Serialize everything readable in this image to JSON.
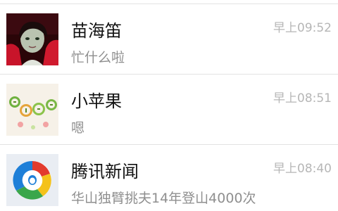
{
  "conversations": [
    {
      "name": "苗海笛",
      "time": "早上09:52",
      "preview": "忙什么啦",
      "avatar_icon": "person-photo-avatar"
    },
    {
      "name": "小苹果",
      "time": "早上08:51",
      "preview": "嗯",
      "avatar_icon": "xiao-pingguo-logo-avatar"
    },
    {
      "name": "腾讯新闻",
      "time": "早上08:40",
      "preview": "华山独臂挑夫14年登山4000次",
      "avatar_icon": "tencent-news-logo-avatar"
    }
  ],
  "colors": {
    "name_text": "#111111",
    "time_text": "#b6b6b6",
    "preview_text": "#8f8f8f",
    "divider": "#e3e3e3",
    "tencent_blue": "#1e7fd8",
    "tencent_red": "#e23b2e",
    "tencent_yellow": "#f4c21b",
    "tencent_green": "#3aa64b"
  }
}
